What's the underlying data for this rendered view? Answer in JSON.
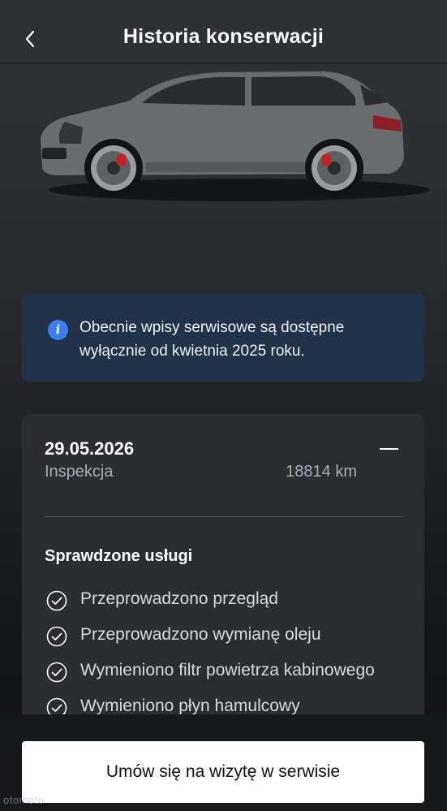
{
  "header": {
    "title": "Historia konserwacji"
  },
  "info_banner": {
    "text": "Obecnie wpisy serwisowe są dostępne wyłącznie od kwietnia 2025 roku."
  },
  "service_entry": {
    "date": "29.05.2026",
    "type": "Inspekcja",
    "mileage": "18814 km",
    "services_title": "Sprawdzone usługi",
    "services": [
      "Przeprowadzono przegląd",
      "Przeprowadzono wymianę oleju",
      "Wymieniono filtr powietrza kabinowego",
      "Wymieniono płyn hamulcowy"
    ]
  },
  "cta": {
    "label": "Umów się na wizytę w serwisie"
  },
  "watermark": "otomoto",
  "colors": {
    "background": "#2a2c30",
    "info_background": "#223248",
    "info_icon": "#3b7ff0",
    "cta_background": "#ffffff"
  }
}
